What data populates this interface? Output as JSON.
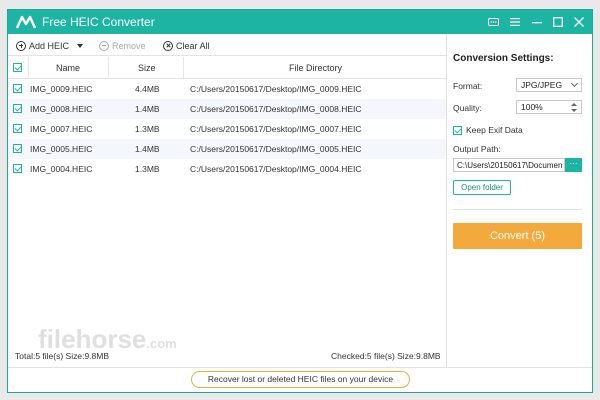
{
  "window": {
    "title": "Free HEIC Converter",
    "accent": "#1eb4a4",
    "convert_color": "#f3a93c"
  },
  "titlebar_icons": [
    "feedback-icon",
    "menu-icon",
    "minimize-icon",
    "maximize-icon",
    "close-icon"
  ],
  "toolbar": {
    "add": "Add HEIC",
    "remove": "Remove",
    "clear": "Clear All"
  },
  "table": {
    "headers": {
      "name": "Name",
      "size": "Size",
      "dir": "File Directory"
    },
    "rows": [
      {
        "name": "IMG_0009.HEIC",
        "size": "4.4MB",
        "dir": "C:/Users/20150617/Desktop/IMG_0009.HEIC",
        "checked": true
      },
      {
        "name": "IMG_0008.HEIC",
        "size": "1.4MB",
        "dir": "C:/Users/20150617/Desktop/IMG_0008.HEIC",
        "checked": true
      },
      {
        "name": "IMG_0007.HEIC",
        "size": "1.3MB",
        "dir": "C:/Users/20150617/Desktop/IMG_0007.HEIC",
        "checked": true
      },
      {
        "name": "IMG_0005.HEIC",
        "size": "1.4MB",
        "dir": "C:/Users/20150617/Desktop/IMG_0005.HEIC",
        "checked": true
      },
      {
        "name": "IMG_0004.HEIC",
        "size": "1.3MB",
        "dir": "C:/Users/20150617/Desktop/IMG_0004.HEIC",
        "checked": true
      }
    ]
  },
  "settings": {
    "title": "Conversion Settings:",
    "format_label": "Format:",
    "format_value": "JPG/JPEG",
    "quality_label": "Quality:",
    "quality_value": "100%",
    "exif_label": "Keep Exif Data",
    "output_label": "Output Path:",
    "output_value": "C:\\Users\\20150617\\Documen",
    "browse_label": "···",
    "open_folder": "Open folder",
    "convert": "Convert (5)"
  },
  "status": {
    "total": "Total:5 file(s) Size:9.8MB",
    "checked": "Checked:5 file(s) Size:9.8MB"
  },
  "watermark": {
    "main": "filehorse",
    "suffix": ".com"
  },
  "footer": {
    "recover": "Recover lost or deleted HEIC files on your device"
  }
}
